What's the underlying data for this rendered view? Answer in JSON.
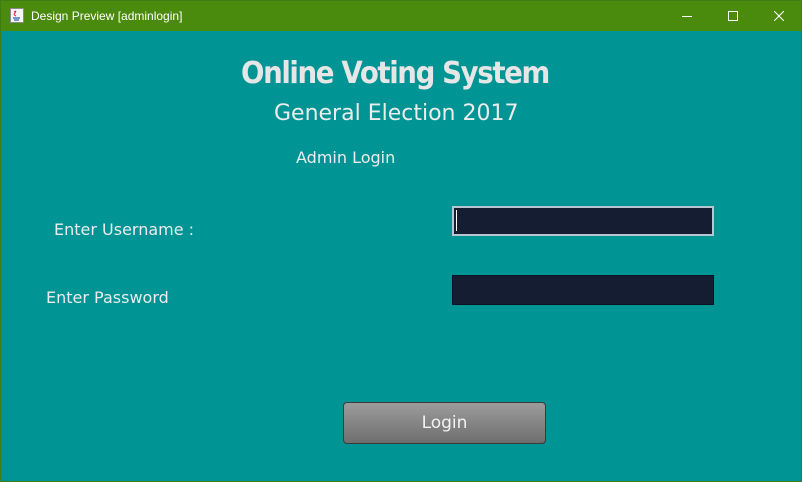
{
  "window": {
    "title": "Design Preview [adminlogin]",
    "background": "#009494",
    "titlebar_color": "#4a8a0c"
  },
  "titlebar_controls": {
    "minimize_icon": "minimize-icon",
    "maximize_icon": "maximize-icon",
    "close_icon": "close-icon"
  },
  "header": {
    "title": "Online Voting System",
    "subtitle": "General Election 2017",
    "section": "Admin Login"
  },
  "form": {
    "username_label": "Enter Username :",
    "username_value": "",
    "password_label": "Enter Password",
    "password_value": "",
    "field_color": "#141d31",
    "login_label": "Login"
  }
}
